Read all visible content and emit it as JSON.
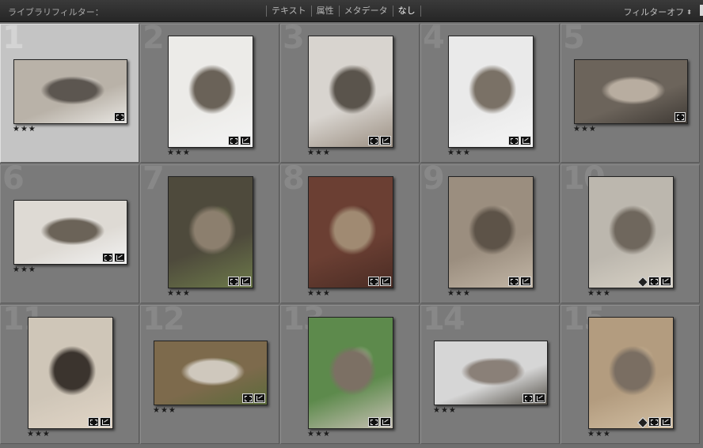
{
  "filter_bar": {
    "label": "ライブラリフィルター：",
    "tabs": [
      "テキスト",
      "属性",
      "メタデータ",
      "なし"
    ],
    "active_tab": "なし",
    "filter_off": "フィルターオフ"
  },
  "grid": {
    "cells": [
      {
        "number": "1",
        "rating": "★★★",
        "orientation": "landscape",
        "badges": [
          "crop-icon"
        ],
        "selected": true,
        "colors": [
          "#b9b2a8",
          "#5c5650",
          "#e8e6e2"
        ]
      },
      {
        "number": "2",
        "rating": "★★★",
        "orientation": "portrait",
        "badges": [
          "crop-icon",
          "adjust-icon"
        ],
        "selected": false,
        "colors": [
          "#ecebe8",
          "#6a6258",
          "#f4f4f4"
        ]
      },
      {
        "number": "3",
        "rating": "★★★",
        "orientation": "portrait",
        "badges": [
          "crop-icon",
          "adjust-icon"
        ],
        "selected": false,
        "colors": [
          "#d8d4cf",
          "#5a544c",
          "#9b8f82"
        ]
      },
      {
        "number": "4",
        "rating": "★★★",
        "orientation": "portrait",
        "badges": [
          "crop-icon",
          "adjust-icon"
        ],
        "selected": false,
        "colors": [
          "#eaeaea",
          "#7a7166",
          "#f5f5f5"
        ]
      },
      {
        "number": "5",
        "rating": "★★★",
        "orientation": "landscape",
        "badges": [
          "crop-icon"
        ],
        "selected": false,
        "colors": [
          "#6c645b",
          "#b8ada0",
          "#3f3a35"
        ]
      },
      {
        "number": "6",
        "rating": "★★★",
        "orientation": "landscape",
        "badges": [
          "crop-icon",
          "adjust-icon"
        ],
        "selected": false,
        "colors": [
          "#dedad4",
          "#6b6358",
          "#f2f2f2"
        ]
      },
      {
        "number": "7",
        "rating": "★★★",
        "orientation": "portrait",
        "badges": [
          "crop-icon",
          "adjust-icon"
        ],
        "selected": false,
        "colors": [
          "#4e4a3c",
          "#8c7f6e",
          "#6d7a4a"
        ]
      },
      {
        "number": "8",
        "rating": "★★★",
        "orientation": "portrait",
        "badges": [
          "crop-icon",
          "adjust-icon"
        ],
        "selected": false,
        "colors": [
          "#6b3f33",
          "#a08a72",
          "#4a2c24"
        ]
      },
      {
        "number": "9",
        "rating": "★★★",
        "orientation": "portrait",
        "badges": [
          "crop-icon",
          "adjust-icon"
        ],
        "selected": false,
        "colors": [
          "#9b8e7f",
          "#5d5348",
          "#c2b6a6"
        ]
      },
      {
        "number": "10",
        "rating": "★★★",
        "orientation": "portrait",
        "badges": [
          "tag-icon",
          "crop-icon",
          "adjust-icon"
        ],
        "selected": false,
        "colors": [
          "#bcb7ae",
          "#6f675d",
          "#d8d2c6"
        ]
      },
      {
        "number": "11",
        "rating": "★★★",
        "orientation": "portrait",
        "badges": [
          "crop-icon",
          "adjust-icon"
        ],
        "selected": false,
        "colors": [
          "#cfc6b8",
          "#3b342e",
          "#e1d5c6"
        ]
      },
      {
        "number": "12",
        "rating": "★★★",
        "orientation": "landscape",
        "badges": [
          "crop-icon",
          "adjust-icon"
        ],
        "selected": false,
        "colors": [
          "#7d6a4c",
          "#cfc8bd",
          "#5a6b3a"
        ]
      },
      {
        "number": "13",
        "rating": "★★★",
        "orientation": "portrait",
        "badges": [
          "crop-icon",
          "adjust-icon"
        ],
        "selected": false,
        "colors": [
          "#5d8a4c",
          "#7c7064",
          "#c7c0b4"
        ]
      },
      {
        "number": "14",
        "rating": "★★★",
        "orientation": "landscape",
        "badges": [
          "crop-icon",
          "adjust-icon"
        ],
        "selected": false,
        "colors": [
          "#d6d6d6",
          "#8a8078",
          "#545048"
        ]
      },
      {
        "number": "15",
        "rating": "★★★",
        "orientation": "portrait",
        "badges": [
          "tag-icon",
          "crop-icon",
          "adjust-icon"
        ],
        "selected": false,
        "colors": [
          "#b39c7f",
          "#7a6e62",
          "#d1bea2"
        ]
      }
    ]
  }
}
